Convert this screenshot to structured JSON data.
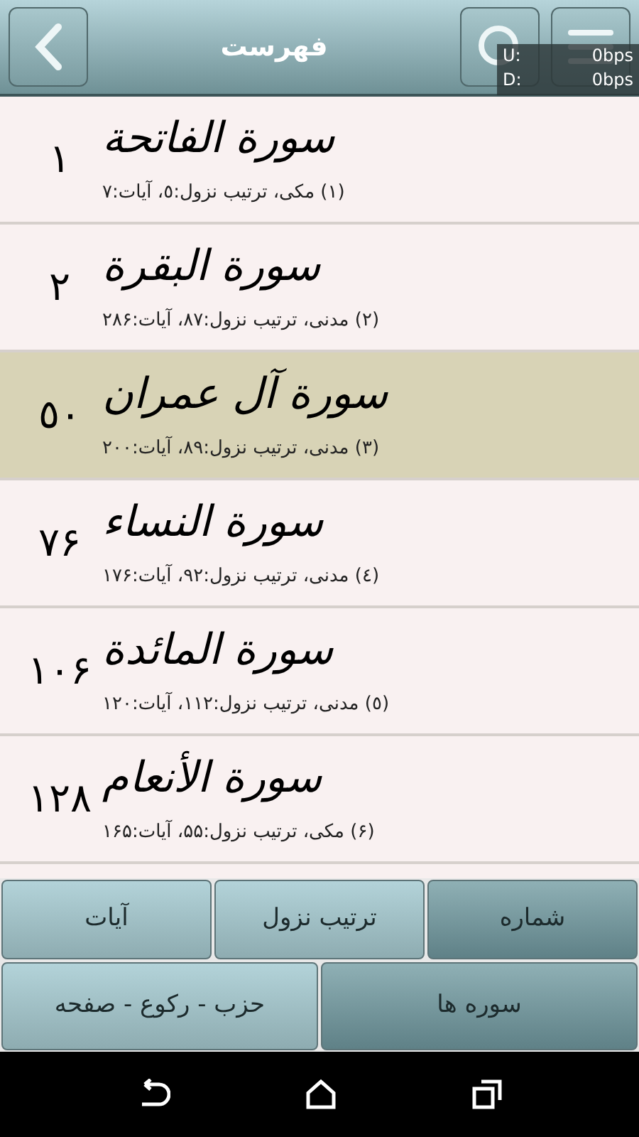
{
  "header": {
    "title": "فهرست"
  },
  "speed_overlay": [
    {
      "label": "U:",
      "value": "0bps"
    },
    {
      "label": "D:",
      "value": "0bps"
    }
  ],
  "surahs": [
    {
      "name": "سورة الفاتحة",
      "info": "(۱) مکی، ترتیب نزول:٥، آیات:۷",
      "page": "۱",
      "selected": false
    },
    {
      "name": "سورة البقرة",
      "info": "(۲) مدنی، ترتیب نزول:۸۷، آیات:۲۸۶",
      "page": "۲",
      "selected": false
    },
    {
      "name": "سورة آل عمران",
      "info": "(۳) مدنی، ترتیب نزول:۸۹، آیات:۲۰۰",
      "page": "٥۰",
      "selected": true
    },
    {
      "name": "سورة النساء",
      "info": "(٤) مدنی، ترتیب نزول:۹۲، آیات:۱۷۶",
      "page": "۷۶",
      "selected": false
    },
    {
      "name": "سورة المائدة",
      "info": "(٥) مدنی، ترتیب نزول:۱۱۲، آیات:۱۲۰",
      "page": "۱۰۶",
      "selected": false
    },
    {
      "name": "سورة الأنعام",
      "info": "(۶) مکی، ترتیب نزول:۵۵، آیات:۱۶۵",
      "page": "۱۲۸",
      "selected": false
    }
  ],
  "sort_tabs": [
    {
      "label": "شماره",
      "selected": true
    },
    {
      "label": "ترتیب نزول",
      "selected": false
    },
    {
      "label": "آیات",
      "selected": false
    }
  ],
  "view_tabs": [
    {
      "label": "سوره ها",
      "selected": true
    },
    {
      "label": "حزب - رکوع - صفحه",
      "selected": false
    }
  ]
}
